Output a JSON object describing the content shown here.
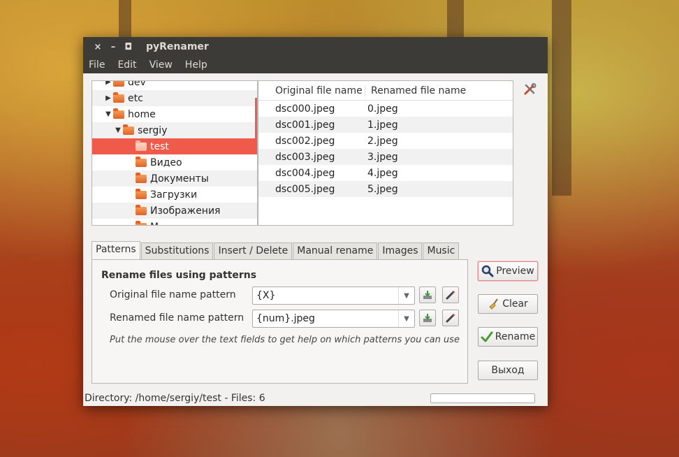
{
  "window": {
    "title": "pyRenamer",
    "controls": {
      "close": "×",
      "minimize": "–",
      "maximize": "◘"
    }
  },
  "menu": {
    "file": "File",
    "edit": "Edit",
    "view": "View",
    "help": "Help"
  },
  "tree": {
    "items": [
      {
        "label": "dev",
        "arrow": "▶"
      },
      {
        "label": "etc",
        "arrow": "▶"
      },
      {
        "label": "home",
        "arrow": "▼"
      },
      {
        "label": "sergiy",
        "arrow": "▼"
      },
      {
        "label": "test",
        "arrow": ""
      },
      {
        "label": "Видео",
        "arrow": ""
      },
      {
        "label": "Документы",
        "arrow": ""
      },
      {
        "label": "Загрузки",
        "arrow": ""
      },
      {
        "label": "Изображения",
        "arrow": ""
      },
      {
        "label": "М",
        "arrow": ""
      }
    ]
  },
  "files": {
    "columns": {
      "original": "Original file name",
      "renamed": "Renamed file name"
    },
    "rows": [
      {
        "original": "dsc000.jpeg",
        "renamed": "0.jpeg"
      },
      {
        "original": "dsc001.jpeg",
        "renamed": "1.jpeg"
      },
      {
        "original": "dsc002.jpeg",
        "renamed": "2.jpeg"
      },
      {
        "original": "dsc003.jpeg",
        "renamed": "3.jpeg"
      },
      {
        "original": "dsc004.jpeg",
        "renamed": "4.jpeg"
      },
      {
        "original": "dsc005.jpeg",
        "renamed": "5.jpeg"
      }
    ]
  },
  "tabs": [
    "Patterns",
    "Substitutions",
    "Insert / Delete",
    "Manual rename",
    "Images",
    "Music"
  ],
  "patterns": {
    "title": "Rename files using patterns",
    "original_label": "Original file name pattern",
    "original_value": "{X}",
    "renamed_label": "Renamed file name pattern",
    "renamed_value": "{num}.jpeg",
    "hint": "Put the mouse over the text fields to get help on which patterns you can use"
  },
  "buttons": {
    "preview": "Preview",
    "clear": "Clear",
    "rename": "Rename",
    "exit": "Выход"
  },
  "status": {
    "text": "Directory: /home/sergiy/test - Files: 6",
    "progress": 0
  },
  "colors": {
    "selection": "#f05a4a",
    "titlebar": "#3c3b37"
  },
  "icons": {
    "tools": "tools-icon",
    "preview": "magnifier-icon",
    "clear": "broom-icon",
    "rename": "checkmark-icon",
    "save": "save-icon",
    "edit": "pencil-icon"
  }
}
